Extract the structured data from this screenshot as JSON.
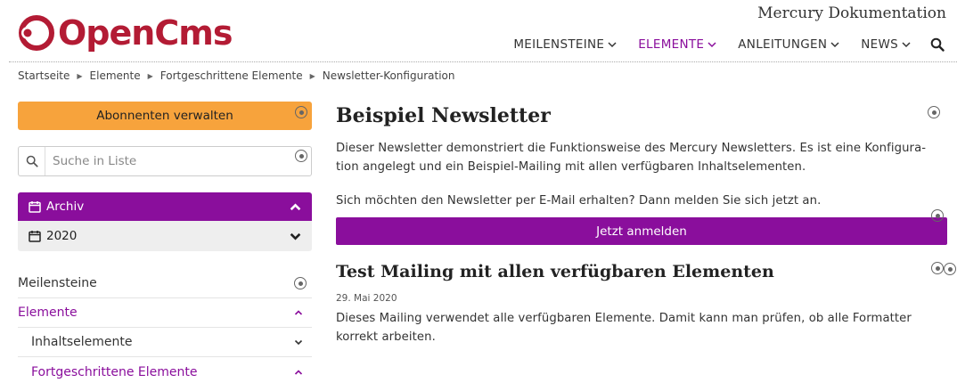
{
  "header": {
    "logo_text": "OpenCms",
    "site_title": "Mercury Dokumentation",
    "nav": [
      {
        "label": "MEILENSTEINE",
        "active": false
      },
      {
        "label": "ELEMENTE",
        "active": true
      },
      {
        "label": "ANLEITUNGEN",
        "active": false
      },
      {
        "label": "NEWS",
        "active": false
      }
    ]
  },
  "breadcrumb": [
    "Startseite",
    "Elemente",
    "Fortgeschrittene Elemente",
    "Newsletter-Konfiguration"
  ],
  "sidebar": {
    "subscribers_button": "Abonnenten verwalten",
    "search_placeholder": "Suche in Liste",
    "archive_label": "Archiv",
    "archive_year": "2020",
    "nav": [
      {
        "label": "Meilensteine",
        "active": false,
        "sub": false
      },
      {
        "label": "Elemente",
        "active": true,
        "sub": false
      },
      {
        "label": "Inhaltselemente",
        "active": false,
        "sub": true
      },
      {
        "label": "Fortgeschrittene Elemente",
        "active": true,
        "sub": true
      }
    ]
  },
  "main": {
    "title": "Beispiel Newsletter",
    "intro": "Dieser Newsletter demonstriert die Funktionsweise des Mercury Newsletters. Es ist eine Konfigura-tion angelegt und ein Beispiel-Mailing mit allen verfügbaren Inhaltselementen.",
    "intro_line1": "Dieser Newsletter demonstriert die Funktionsweise des Mercury Newsletters. Es ist eine Konfigura-",
    "intro_line2": "tion angelegt und ein Beispiel-Mailing mit allen verfügbaren Inhaltselementen.",
    "signup_text": "Sich möchten den Newsletter per E-Mail erhalten? Dann melden Sie sich jetzt an.",
    "signup_button": "Jetzt anmelden",
    "mailing_title": "Test Mailing mit allen verfügbaren Elementen",
    "mailing_date": "29. Mai 2020",
    "mailing_text_line1": "Dieses Mailing verwendet alle verfügbaren Elemente. Damit kann man prüfen, ob alle Formatter",
    "mailing_text_line2": "korrekt arbeiten."
  },
  "colors": {
    "brand_red": "#b31b34",
    "accent_purple": "#8a0e9c",
    "orange": "#f7a33c"
  },
  "icons": [
    "opencms-logo-icon",
    "chevron-down-icon",
    "search-icon",
    "edit-point-icon",
    "calendar-icon",
    "chevron-up-icon",
    "breadcrumb-arrow-icon"
  ]
}
